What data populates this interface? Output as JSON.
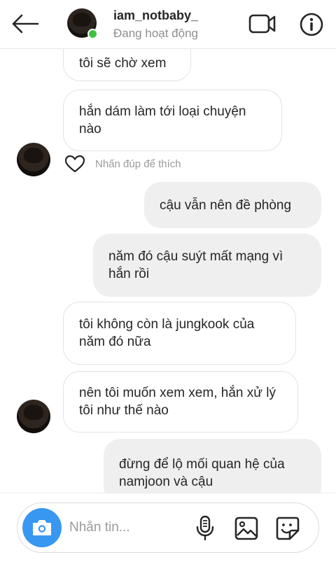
{
  "header": {
    "username": "iam_notbaby_",
    "status": "Đang hoạt động"
  },
  "messages": [
    {
      "direction": "incoming",
      "text": "tôi sẽ chờ xem"
    },
    {
      "direction": "incoming",
      "text": "hắn dám làm tới loại chuyện nào"
    },
    {
      "direction": "outgoing",
      "text": "cậu vẫn nên đề phòng"
    },
    {
      "direction": "outgoing",
      "text": "năm đó cậu suýt mất mạng vì hắn rồi"
    },
    {
      "direction": "incoming",
      "text": "tôi không còn là jungkook của năm đó nữa"
    },
    {
      "direction": "incoming",
      "text": "nên tôi muốn xem xem, hắn xử lý tôi như thế nào"
    },
    {
      "direction": "outgoing",
      "text": "đừng để lộ mối quan hệ của namjoon và cậu"
    }
  ],
  "like_hint": "Nhấn đúp để thích",
  "composer": {
    "placeholder": "Nhắn tin..."
  },
  "icons": {
    "back": "arrow-left-icon",
    "video": "video-camera-icon",
    "info": "info-icon",
    "like": "heart-icon",
    "camera": "camera-icon",
    "mic": "microphone-icon",
    "gallery": "image-icon",
    "sticker": "sticker-icon"
  },
  "colors": {
    "accent_blue": "#3897f0",
    "online_green": "#3ec23e",
    "outgoing_bubble": "#efefef",
    "muted_text": "#8e8e8e"
  }
}
